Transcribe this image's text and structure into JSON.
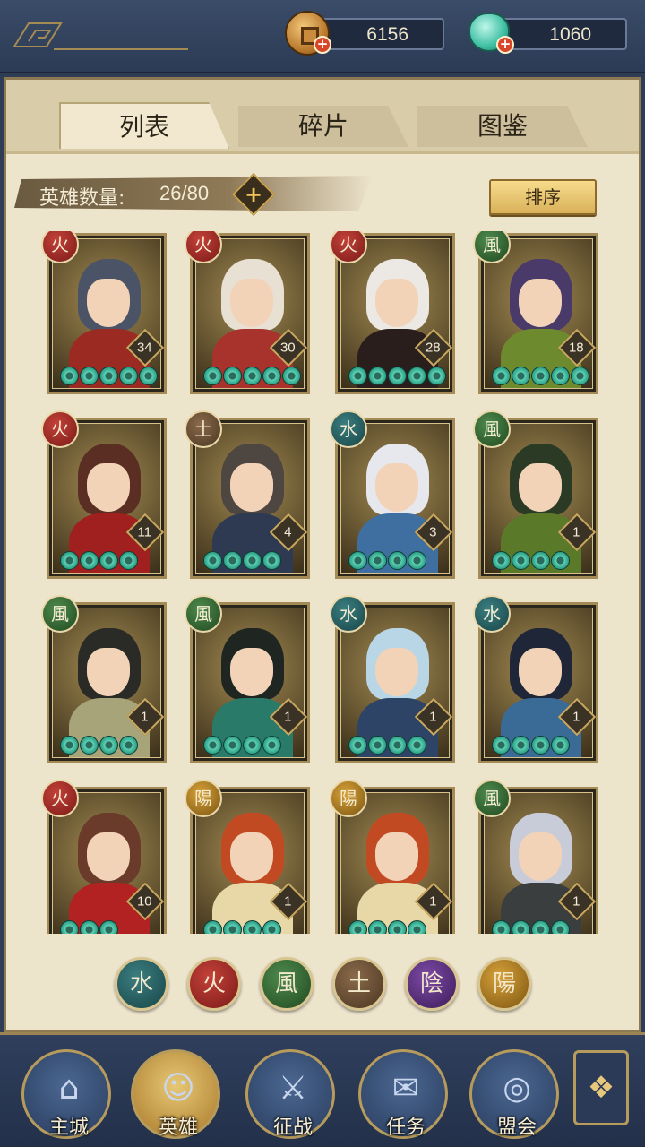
{
  "resources": {
    "coin_value": "6156",
    "jade_value": "1060"
  },
  "tabs": [
    {
      "label": "列表",
      "active": true
    },
    {
      "label": "碎片",
      "active": false
    },
    {
      "label": "图鉴",
      "active": false
    }
  ],
  "hero_count": {
    "label": "英雄数量:",
    "value": "26/80"
  },
  "sort_label": "排序",
  "heroes": [
    {
      "element": "火",
      "level": "34",
      "stars": 5,
      "hair": "#4a5466",
      "outfit": "#9b2a22"
    },
    {
      "element": "火",
      "level": "30",
      "stars": 5,
      "hair": "#e8e0d2",
      "outfit": "#a8322c"
    },
    {
      "element": "火",
      "level": "28",
      "stars": 5,
      "hair": "#ece8e4",
      "outfit": "#2a1e1c"
    },
    {
      "element": "風",
      "level": "18",
      "stars": 5,
      "hair": "#4a3a6a",
      "outfit": "#6d8a2e"
    },
    {
      "element": "火",
      "level": "11",
      "stars": 4,
      "hair": "#5a2e22",
      "outfit": "#a01f1f"
    },
    {
      "element": "土",
      "level": "4",
      "stars": 4,
      "hair": "#4e4640",
      "outfit": "#2e3a52"
    },
    {
      "element": "水",
      "level": "3",
      "stars": 4,
      "hair": "#e6e8ee",
      "outfit": "#3f6fa0"
    },
    {
      "element": "風",
      "level": "1",
      "stars": 4,
      "hair": "#2a3a24",
      "outfit": "#5a7a2a"
    },
    {
      "element": "風",
      "level": "1",
      "stars": 4,
      "hair": "#2a2a26",
      "outfit": "#a8a47a"
    },
    {
      "element": "風",
      "level": "1",
      "stars": 4,
      "hair": "#1f2622",
      "outfit": "#2a7a6a"
    },
    {
      "element": "水",
      "level": "1",
      "stars": 4,
      "hair": "#b8d6e6",
      "outfit": "#2e4466"
    },
    {
      "element": "水",
      "level": "1",
      "stars": 4,
      "hair": "#1f2638",
      "outfit": "#3a6a96"
    },
    {
      "element": "火",
      "level": "10",
      "stars": 3,
      "hair": "#6a3a2a",
      "outfit": "#b22222"
    },
    {
      "element": "陽",
      "level": "1",
      "stars": 4,
      "hair": "#c24a22",
      "outfit": "#e8d8a8"
    },
    {
      "element": "陽",
      "level": "1",
      "stars": 4,
      "hair": "#c24a22",
      "outfit": "#e8d8a8"
    },
    {
      "element": "風",
      "level": "1",
      "stars": 4,
      "hair": "#c8ccd8",
      "outfit": "#3a3e3e"
    }
  ],
  "element_filters": [
    {
      "glyph": "水",
      "cls": "el-water"
    },
    {
      "glyph": "火",
      "cls": "el-fire"
    },
    {
      "glyph": "風",
      "cls": "el-wind"
    },
    {
      "glyph": "土",
      "cls": "el-earth"
    },
    {
      "glyph": "陰",
      "cls": "el-yin"
    },
    {
      "glyph": "陽",
      "cls": "el-yang"
    }
  ],
  "nav": [
    {
      "label": "主城",
      "glyph": "⌂",
      "icon": "palace-icon",
      "active": false
    },
    {
      "label": "英雄",
      "glyph": "☺",
      "icon": "hero-portrait-icon",
      "active": true
    },
    {
      "label": "征战",
      "glyph": "⚔",
      "icon": "battle-icon",
      "active": false
    },
    {
      "label": "任务",
      "glyph": "✉",
      "icon": "quest-scroll-icon",
      "active": false
    },
    {
      "label": "盟会",
      "glyph": "◎",
      "icon": "guild-icon",
      "active": false
    }
  ],
  "side_button_glyph": "❖"
}
